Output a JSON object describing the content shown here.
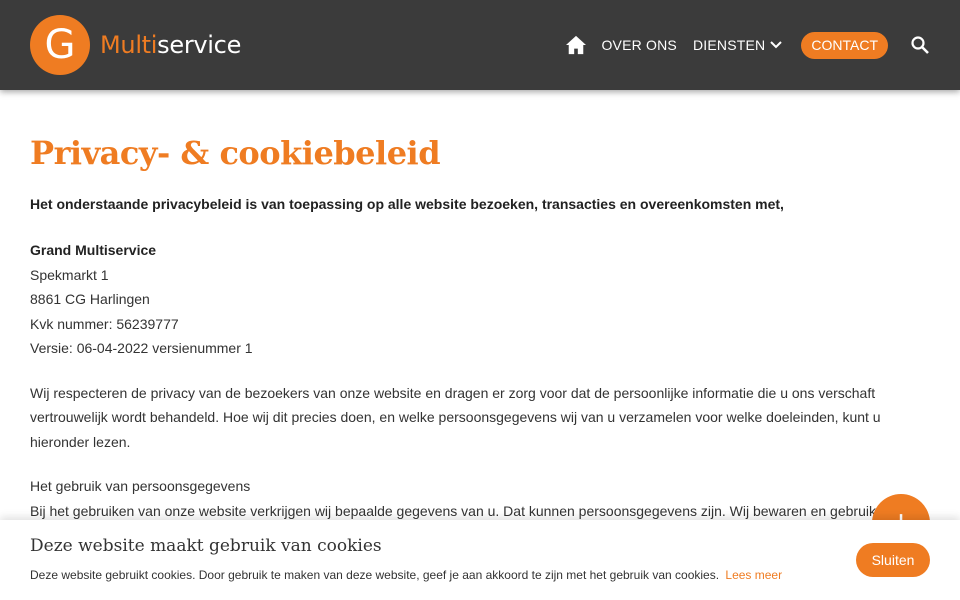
{
  "brand": {
    "logo_letter": "G",
    "name_part1": "Multi",
    "name_part2": "service",
    "accent_color": "#ef7c22",
    "header_color": "#3b3b3b"
  },
  "nav": {
    "home_icon": "home-icon",
    "items": [
      {
        "label": "OVER ONS"
      },
      {
        "label": "DIENSTEN",
        "has_dropdown": true
      }
    ],
    "contact_label": "CONTACT",
    "search_icon": "search-icon"
  },
  "page": {
    "title": "Privacy- & cookiebeleid",
    "intro": "Het onderstaande privacybeleid is van toepassing op alle website bezoeken, transacties en overeenkomsten met,",
    "address": {
      "company": "Grand Multiservice",
      "street": "Spekmarkt 1",
      "city": "8861 CG Harlingen",
      "kvk": "Kvk nummer: 56239777",
      "version": "Versie: 06-04-2022 versienummer 1"
    },
    "para1": "Wij respecteren de privacy van de bezoekers van onze website en dragen er zorg voor dat de persoonlijke informatie die u ons verschaft vertrouwelijk wordt behandeld. Hoe wij dit precies doen, en welke persoonsgegevens wij van u verzamelen voor welke doeleinden, kunt u hieronder lezen.",
    "section_heading": "Het gebruik van persoonsgegevens",
    "section_text": "Bij het gebruiken van onze website verkrijgen wij bepaalde gegevens van u. Dat kunnen persoonsgegevens zijn. Wij bewaren en gebruiken"
  },
  "fab": {
    "icon": "plus-icon",
    "glyph": "+"
  },
  "cookie": {
    "title": "Deze website maakt gebruik van cookies",
    "text": "Deze website gebruikt cookies. Door gebruik te maken van deze website, geef je aan akkoord te zijn met het gebruik van cookies.",
    "link": "Lees meer",
    "button": "Sluiten"
  }
}
